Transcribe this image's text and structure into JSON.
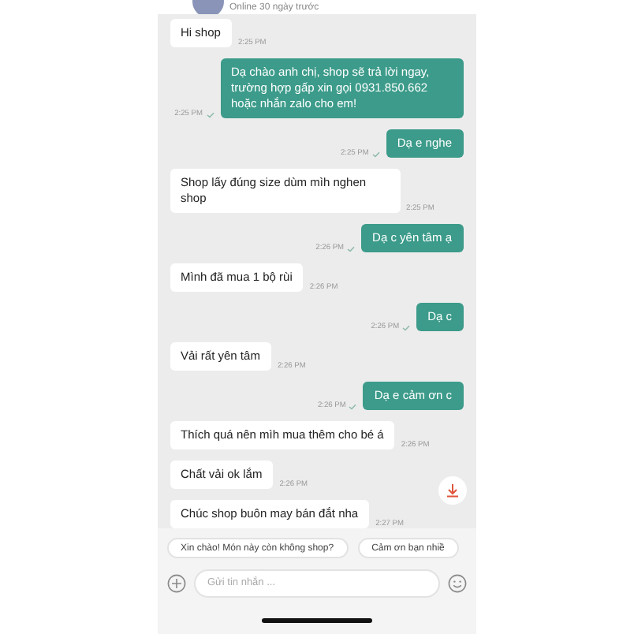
{
  "header": {
    "status": "Online 30 ngày trước"
  },
  "messages": [
    {
      "kind": "in",
      "text": "Hi shop",
      "time": "2:25 PM"
    },
    {
      "kind": "out",
      "text": "Dạ chào anh chị, shop sẽ trả lời ngay, trường hợp gấp xin gọi 0931.850.662 hoặc nhắn zalo cho em!",
      "time": "2:25 PM",
      "read": true
    },
    {
      "kind": "out",
      "text": "Dạ e nghe",
      "time": "2:25 PM",
      "read": true
    },
    {
      "kind": "in",
      "text": "Shop lấy đúng size dùm mìh nghen shop",
      "time": "2:25 PM"
    },
    {
      "kind": "out",
      "text": "Dạ c yên tâm ạ",
      "time": "2:26 PM",
      "read": true
    },
    {
      "kind": "in",
      "text": "Mình đã mua 1 bộ rùi",
      "time": "2:26 PM"
    },
    {
      "kind": "out",
      "text": "Dạ c",
      "time": "2:26 PM",
      "read": true
    },
    {
      "kind": "in",
      "text": "Vải rất yên tâm",
      "time": "2:26 PM"
    },
    {
      "kind": "out",
      "text": "Dạ e cảm ơn c",
      "time": "2:26 PM",
      "read": true
    },
    {
      "kind": "in",
      "text": "Thích quá nên mìh mua thêm cho bé á",
      "time": "2:26 PM"
    },
    {
      "kind": "in",
      "text": "Chất vải ok lắm",
      "time": "2:26 PM"
    },
    {
      "kind": "in",
      "text": "Chúc shop buôn may bán đắt nha",
      "time": "2:27 PM"
    }
  ],
  "quick_replies": [
    "Xin chào! Món này còn không shop?",
    "Cảm ơn bạn nhiề"
  ],
  "composer": {
    "placeholder": "Gửi tin nhắn ..."
  }
}
